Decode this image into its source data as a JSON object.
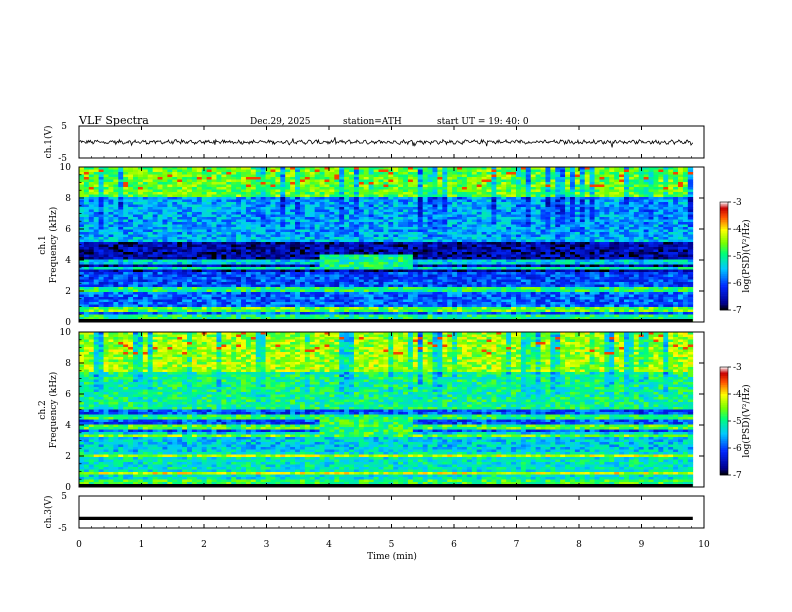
{
  "header": {
    "title": "VLF  Spectra",
    "date": "Dec.29, 2025",
    "station": "station=ATH",
    "start": "start  UT  =    19: 40: 0"
  },
  "chart_data": [
    {
      "type": "line",
      "panel": "ch1-waveform",
      "ylabel": "ch.1(V)",
      "ylim": [
        -5,
        5
      ],
      "yticks": [
        "5",
        "-5"
      ],
      "xlim": [
        0,
        10
      ],
      "baseline": 0,
      "amplitude_range": [
        -0.8,
        0.8
      ],
      "note_values": "broadband noisy waveform around 0 V"
    },
    {
      "type": "heatmap",
      "panel": "ch1-spectrogram",
      "ylabel": "Frequency  (kHz)",
      "channel_label": "ch.1",
      "ylim": [
        0,
        10
      ],
      "yticks": [
        "0",
        "2",
        "4",
        "6",
        "8",
        "10"
      ],
      "xlim": [
        0,
        10
      ],
      "colorbar": {
        "label": "log(PSD)(V²/Hz)",
        "ticks": [
          "-3",
          "-4",
          "-5",
          "-6",
          "-7"
        ],
        "range": [
          -7,
          -3
        ]
      },
      "bands": [
        {
          "f": [
            8.0,
            10.0
          ],
          "level": -4.6
        },
        {
          "f": [
            5.5,
            8.0
          ],
          "level": -5.6
        },
        {
          "f": [
            3.2,
            5.5
          ],
          "level": -6.6
        },
        {
          "f": [
            2.2,
            3.2
          ],
          "level": -6.0
        },
        {
          "f": [
            0.5,
            2.2
          ],
          "level": -5.9
        },
        {
          "f": [
            0.0,
            0.5
          ],
          "level": -5.0
        }
      ],
      "lines": [
        {
          "f": 2.1,
          "level": -4.9
        },
        {
          "f": 3.5,
          "level": -5.2
        },
        {
          "f": 3.9,
          "level": -5.4
        },
        {
          "f": 5.3,
          "level": -5.5
        },
        {
          "f": 0.8,
          "level": -4.6
        }
      ],
      "events": [
        {
          "t": [
            3.82,
            5.38
          ],
          "f": [
            3.5,
            4.4
          ],
          "level": -5.0
        }
      ]
    },
    {
      "type": "heatmap",
      "panel": "ch2-spectrogram",
      "ylabel": "Frequency  (kHz)",
      "channel_label": "ch.2",
      "ylim": [
        0,
        10
      ],
      "yticks": [
        "0",
        "2",
        "4",
        "6",
        "8",
        "10"
      ],
      "xlim": [
        0,
        10
      ],
      "colorbar": {
        "label": "log(PSD)(V²/Hz)",
        "ticks": [
          "-3",
          "-4",
          "-5",
          "-6",
          "-7"
        ],
        "range": [
          -7,
          -3
        ]
      },
      "bands": [
        {
          "f": [
            7.5,
            10.0
          ],
          "level": -4.4
        },
        {
          "f": [
            5.0,
            7.5
          ],
          "level": -5.0
        },
        {
          "f": [
            3.6,
            5.0
          ],
          "level": -6.0
        },
        {
          "f": [
            2.2,
            3.6
          ],
          "level": -5.4
        },
        {
          "f": [
            0.5,
            2.2
          ],
          "level": -5.2
        },
        {
          "f": [
            0.0,
            0.5
          ],
          "level": -4.8
        }
      ],
      "lines": [
        {
          "f": 2.0,
          "level": -4.3
        },
        {
          "f": 3.3,
          "level": -4.5
        },
        {
          "f": 3.9,
          "level": -4.7
        },
        {
          "f": 4.5,
          "level": -4.9
        },
        {
          "f": 0.9,
          "level": -4.2
        }
      ],
      "events": [
        {
          "t": [
            3.82,
            5.38
          ],
          "f": [
            3.3,
            4.3
          ],
          "level": -4.8
        }
      ]
    },
    {
      "type": "line",
      "panel": "ch3-waveform",
      "ylabel": "ch.3(V)",
      "ylim": [
        -5,
        5
      ],
      "yticks": [
        "5",
        "-5"
      ],
      "xlim": [
        0,
        10
      ],
      "xlabel": "Time  (min)",
      "xticks": [
        "0",
        "1",
        "2",
        "3",
        "4",
        "5",
        "6",
        "7",
        "8",
        "9",
        "10"
      ],
      "baseline": -2,
      "amplitude_range": [
        -0.2,
        0.2
      ]
    }
  ]
}
